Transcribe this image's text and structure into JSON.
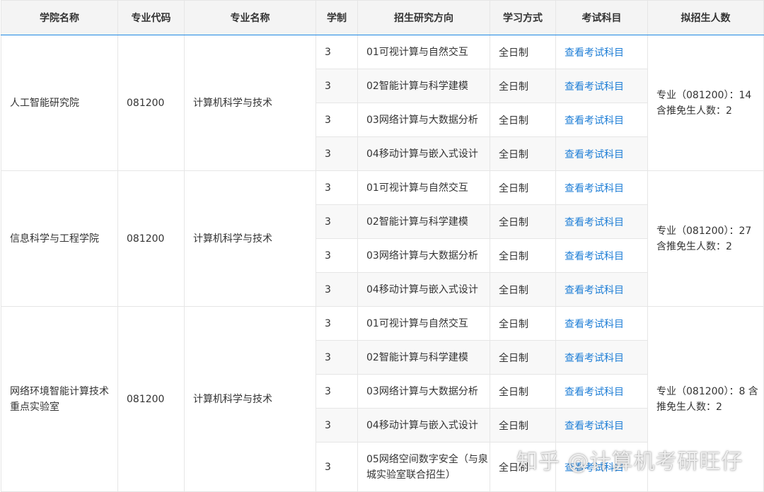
{
  "headers": [
    "学院名称",
    "专业代码",
    "专业名称",
    "学制",
    "招生研究方向",
    "学习方式",
    "考试科目",
    "拟招生人数"
  ],
  "groups": [
    {
      "college": "人工智能研究院",
      "code": "081200",
      "major": "计算机科学与技术",
      "quota": "专业（081200）：14 含推免生人数：2",
      "rows": [
        {
          "years": "3",
          "direction": "01可视计算与自然交互",
          "mode": "全日制",
          "exam": "查看考试科目"
        },
        {
          "years": "3",
          "direction": "02智能计算与科学建模",
          "mode": "全日制",
          "exam": "查看考试科目"
        },
        {
          "years": "3",
          "direction": "03网络计算与大数据分析",
          "mode": "全日制",
          "exam": "查看考试科目"
        },
        {
          "years": "3",
          "direction": "04移动计算与嵌入式设计",
          "mode": "全日制",
          "exam": "查看考试科目"
        }
      ]
    },
    {
      "college": "信息科学与工程学院",
      "code": "081200",
      "major": "计算机科学与技术",
      "quota": "专业（081200）：27 含推免生人数：2",
      "rows": [
        {
          "years": "3",
          "direction": "01可视计算与自然交互",
          "mode": "全日制",
          "exam": "查看考试科目"
        },
        {
          "years": "3",
          "direction": "02智能计算与科学建模",
          "mode": "全日制",
          "exam": "查看考试科目"
        },
        {
          "years": "3",
          "direction": "03网络计算与大数据分析",
          "mode": "全日制",
          "exam": "查看考试科目"
        },
        {
          "years": "3",
          "direction": "04移动计算与嵌入式设计",
          "mode": "全日制",
          "exam": "查看考试科目"
        }
      ]
    },
    {
      "college": "网络环境智能计算技术重点实验室",
      "code": "081200",
      "major": "计算机科学与技术",
      "quota": "专业（081200）：8 含推免生人数：2",
      "rows": [
        {
          "years": "3",
          "direction": "01可视计算与自然交互",
          "mode": "全日制",
          "exam": "查看考试科目"
        },
        {
          "years": "3",
          "direction": "02智能计算与科学建模",
          "mode": "全日制",
          "exam": "查看考试科目"
        },
        {
          "years": "3",
          "direction": "03网络计算与大数据分析",
          "mode": "全日制",
          "exam": "查看考试科目"
        },
        {
          "years": "3",
          "direction": "04移动计算与嵌入式设计",
          "mode": "全日制",
          "exam": "查看考试科目"
        },
        {
          "years": "3",
          "direction": "05网络空间数字安全（与泉城实验室联合招生）",
          "mode": "全日制",
          "exam": "查看考试科目"
        }
      ]
    }
  ],
  "watermark": "知乎 @计算机考研旺仔",
  "colors": {
    "link": "#1e7ed6",
    "header_bg": "#f4f4f4",
    "header_rule": "#1e88e5"
  }
}
